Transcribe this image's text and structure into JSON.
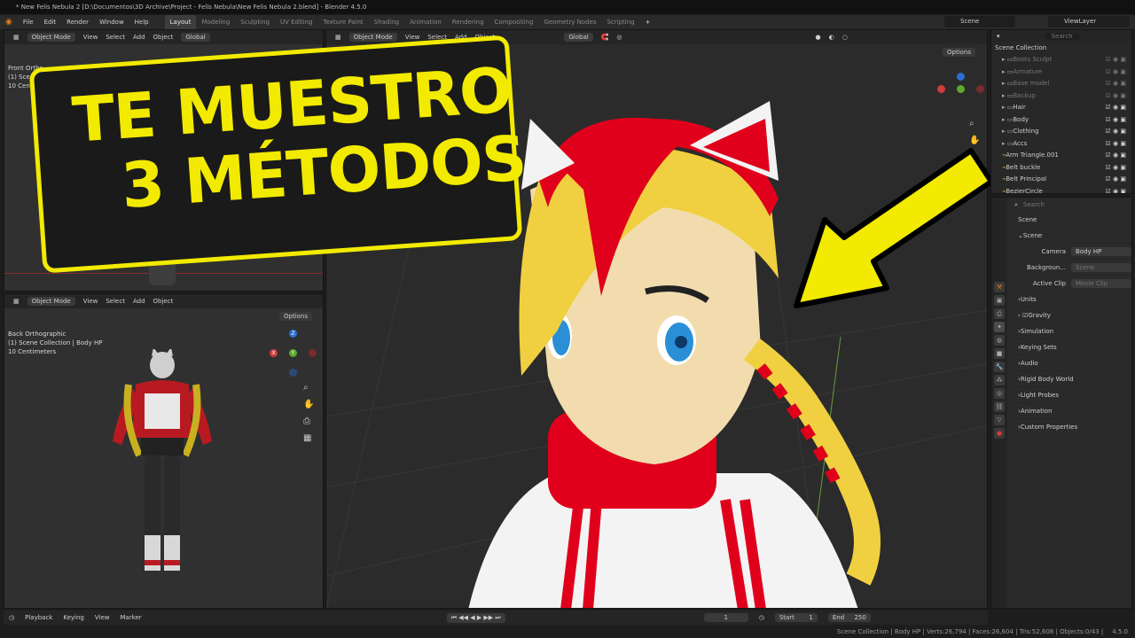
{
  "window": {
    "title": "* New Felis Nebula 2 [D:\\Documentos\\3D Archive\\Project - Felis Nebula\\New Felis Nebula 2.blend] - Blender 4.5.0"
  },
  "menu": {
    "items": [
      "File",
      "Edit",
      "Render",
      "Window",
      "Help"
    ],
    "tabs": [
      "Layout",
      "Modeling",
      "Sculpting",
      "UV Editing",
      "Texture Paint",
      "Shading",
      "Animation",
      "Rendering",
      "Compositing",
      "Geometry Nodes",
      "Scripting"
    ],
    "scene": "Scene",
    "view_layer": "ViewLayer"
  },
  "viewport_header": {
    "mode": "Object Mode",
    "view": "View",
    "select": "Select",
    "add": "Add",
    "object": "Object",
    "transform": "Global",
    "options": "Options"
  },
  "top_left_viewport": {
    "line1": "Front Ortho",
    "line2": "(1) Scen",
    "line3": "10 Centim"
  },
  "bottom_left_viewport": {
    "line1": "Back Orthographic",
    "line2": "(1) Scene Collection | Body HP",
    "line3": "10 Centimeters"
  },
  "gizmo": {
    "x": "X",
    "y": "Y",
    "z": "Z"
  },
  "overlay": {
    "line1": "TE MUESTRO",
    "line2": "3 MÉTODOS"
  },
  "outliner": {
    "header": "Scene Collection",
    "search_placeholder": "Search",
    "items": [
      {
        "name": "Boots Sculpt",
        "dim": true
      },
      {
        "name": "Armature",
        "dim": true
      },
      {
        "name": "Base model",
        "dim": true
      },
      {
        "name": "Backup",
        "dim": true
      },
      {
        "name": "Hair",
        "dim": false
      },
      {
        "name": "Body",
        "dim": false
      },
      {
        "name": "Clothing",
        "dim": false
      },
      {
        "name": "Accs",
        "dim": false
      },
      {
        "name": "Arm Triangle.001",
        "dim": false
      },
      {
        "name": "Belt buckle",
        "dim": false
      },
      {
        "name": "Belt Principal",
        "dim": false
      },
      {
        "name": "BezierCircle",
        "dim": false
      }
    ]
  },
  "properties": {
    "search_placeholder": "Search",
    "context": "Scene",
    "panel": "Scene",
    "camera_label": "Camera",
    "camera_value": "Body HP",
    "background_label": "Backgroun...",
    "background_value": "Scene",
    "clip_label": "Active Clip",
    "clip_value": "Movie Clip",
    "panels": [
      "Units",
      "Gravity",
      "Simulation",
      "Keying Sets",
      "Audio",
      "Rigid Body World",
      "Light Probes",
      "Animation",
      "Custom Properties"
    ]
  },
  "timeline": {
    "playback": "Playback",
    "keying": "Keying",
    "view": "View",
    "marker": "Marker",
    "current_frame": "1",
    "start_label": "Start",
    "start": "1",
    "end_label": "End",
    "end": "250"
  },
  "status": {
    "text": "Scene Collection | Body HP | Verts:26,794 | Faces:26,604 | Tris:52,608 | Objects:0/43 |",
    "version": "4.5.0"
  },
  "colors": {
    "accent_yellow": "#f2ea00",
    "overlay_bg": "#1a1a1a",
    "hair_red": "#e0001b",
    "hair_blonde": "#f0d040"
  }
}
